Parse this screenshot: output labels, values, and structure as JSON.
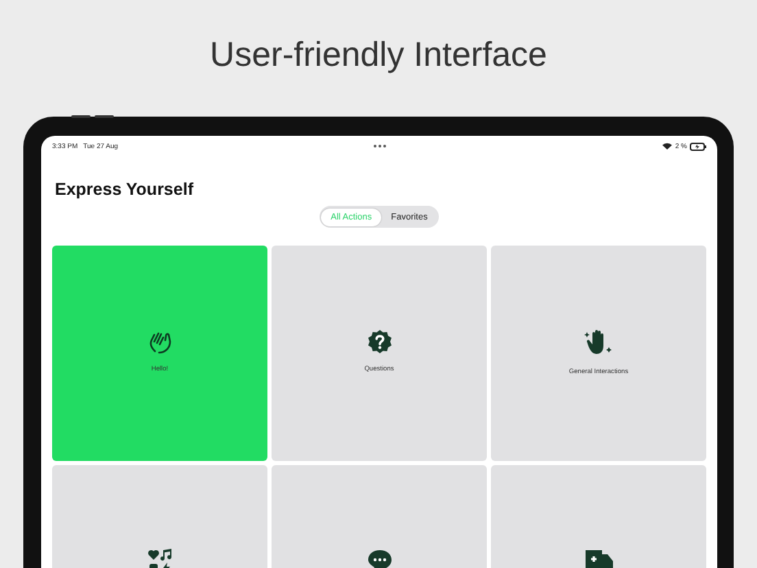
{
  "headline": "User-friendly Interface",
  "status_bar": {
    "time": "3:33 PM",
    "date": "Tue 27 Aug",
    "battery": "2 %"
  },
  "title": "Express Yourself",
  "segments": [
    {
      "label": "All Actions",
      "selected": true
    },
    {
      "label": "Favorites",
      "selected": false
    }
  ],
  "tiles": [
    {
      "label": "Hello!",
      "kind": "wave",
      "selected": true
    },
    {
      "label": "Questions",
      "kind": "question",
      "selected": false
    },
    {
      "label": "General Interactions",
      "kind": "sparklehand",
      "selected": false
    },
    {
      "kind": "hobbies",
      "selected": false
    },
    {
      "kind": "chat",
      "selected": false
    },
    {
      "kind": "ambulance",
      "selected": false
    }
  ]
}
